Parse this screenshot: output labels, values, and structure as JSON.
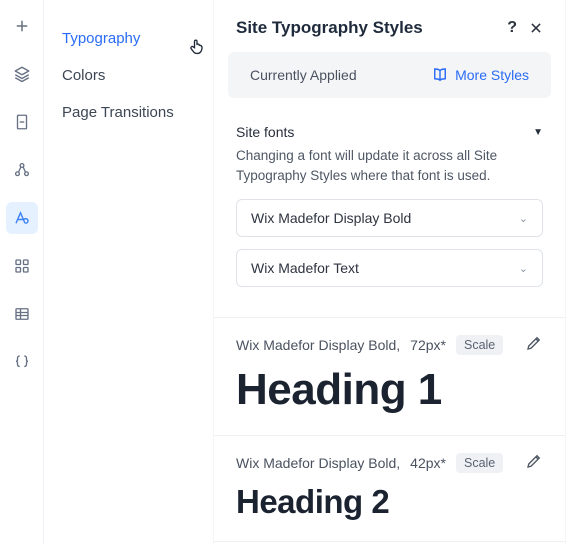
{
  "subnav": {
    "items": [
      "Typography",
      "Colors",
      "Page Transitions"
    ],
    "activeIndex": 0
  },
  "panel": {
    "title": "Site Typography Styles",
    "help": "?",
    "applied_label": "Currently Applied",
    "more_styles_label": "More Styles"
  },
  "siteFonts": {
    "heading": "Site fonts",
    "description": "Changing a font will update it across all Site Typography Styles where that font is used.",
    "font1": "Wix Madefor Display Bold",
    "font2": "Wix Madefor Text"
  },
  "headings": [
    {
      "font": "Wix Madefor Display Bold",
      "size": "72px*",
      "scale_label": "Scale",
      "sample": "Heading 1"
    },
    {
      "font": "Wix Madefor Display Bold",
      "size": "42px*",
      "scale_label": "Scale",
      "sample": "Heading 2"
    }
  ]
}
